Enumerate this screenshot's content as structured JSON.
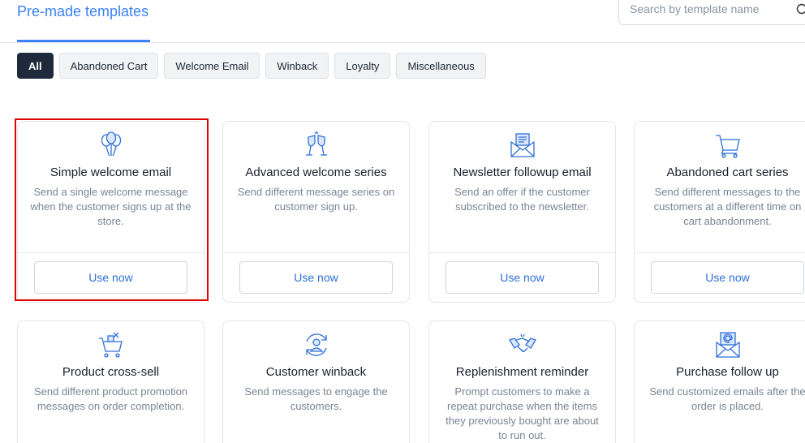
{
  "header": {
    "active_tab": "Pre-made templates",
    "search_placeholder": "Search by template name"
  },
  "filters": [
    "All",
    "Abandoned Cart",
    "Welcome Email",
    "Winback",
    "Loyalty",
    "Miscellaneous"
  ],
  "filters_selected": "All",
  "cards": [
    {
      "icon": "balloons-icon",
      "title": "Simple welcome email",
      "desc": "Send a single welcome message when the customer signs up at the store.",
      "button": "Use now"
    },
    {
      "icon": "champagne-glasses-icon",
      "title": "Advanced welcome series",
      "desc": "Send different message series on customer sign up.",
      "button": "Use now"
    },
    {
      "icon": "envelope-letter-icon",
      "title": "Newsletter followup email",
      "desc": "Send an offer if the customer subscribed to the newsletter.",
      "button": "Use now"
    },
    {
      "icon": "shopping-cart-icon",
      "title": "Abandoned cart series",
      "desc": "Send different messages to the customers at a different time on cart abandonment.",
      "button": "Use now"
    },
    {
      "icon": "cart-crosssell-icon",
      "title": "Product cross-sell",
      "desc": "Send different product promotion messages on order completion."
    },
    {
      "icon": "customer-refresh-icon",
      "title": "Customer winback",
      "desc": "Send messages to engage the customers."
    },
    {
      "icon": "handshake-icon",
      "title": "Replenishment reminder",
      "desc": "Prompt customers to make a repeat purchase when the items they previously bought are about to run out."
    },
    {
      "icon": "envelope-at-icon",
      "title": "Purchase follow up",
      "desc": "Send customized emails after the order is placed."
    }
  ],
  "colors": {
    "accent": "#3b82f6",
    "active_chip": "#1e2a3b",
    "button_text": "#2f6fd8",
    "highlight": "#e00000",
    "icon": "#2f6fd8"
  }
}
